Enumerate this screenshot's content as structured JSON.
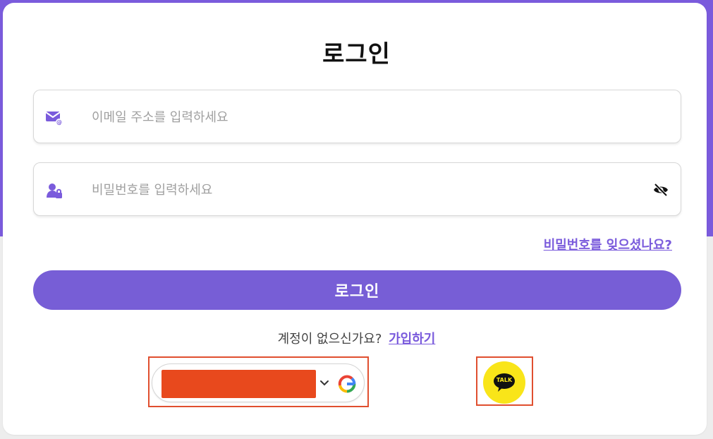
{
  "page": {
    "title": "로그인"
  },
  "form": {
    "email_placeholder": "이메일 주소를 입력하세요",
    "password_placeholder": "비밀번호를 입력하세요",
    "forgot_password": "비밀번호를 잊으셨나요?",
    "login_button": "로그인"
  },
  "signup": {
    "prompt": "계정이 없으신가요?",
    "link": "가입하기"
  },
  "social": {
    "google_icon": "google-icon",
    "chevron_icon": "chevron-down-icon",
    "kakao_label": "TALK"
  },
  "icons": {
    "email": "email-icon",
    "password": "user-lock-icon",
    "visibility": "eye-slash-icon"
  },
  "colors": {
    "accent": "#7A5BDC",
    "kakao": "#F9E519",
    "highlight": "#E04F2F"
  }
}
